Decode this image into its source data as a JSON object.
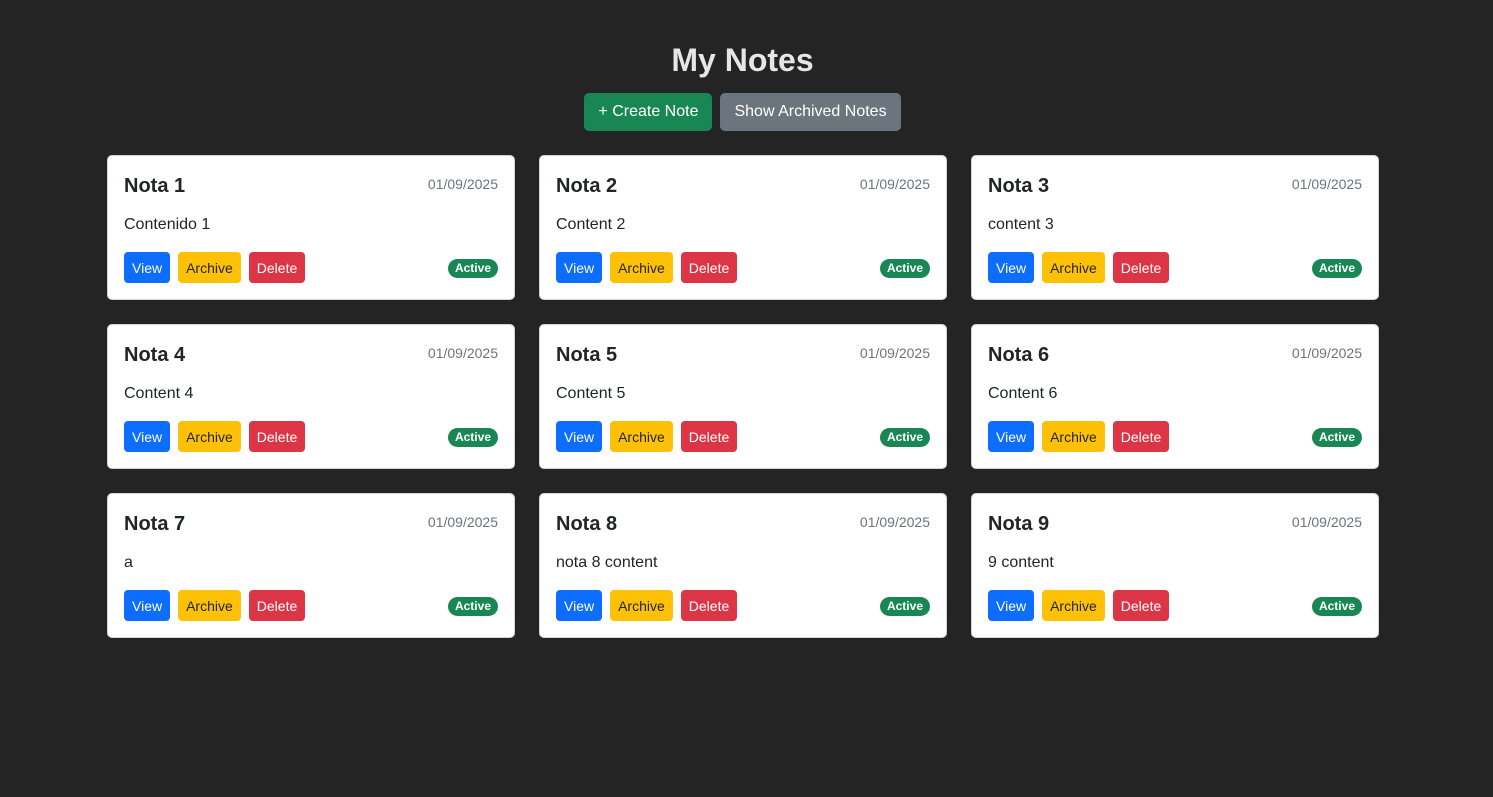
{
  "header": {
    "title": "My Notes",
    "create_label": "+ Create Note",
    "show_archived_label": "Show Archived Notes"
  },
  "colors": {
    "background": "#242424",
    "create": "#198754",
    "show_archived": "#6c757d",
    "view": "#0d6efd",
    "archive": "#ffc107",
    "delete": "#dc3545",
    "badge_active": "#198754"
  },
  "actions": {
    "view_label": "View",
    "archive_label": "Archive",
    "delete_label": "Delete"
  },
  "notes": [
    {
      "title": "Nota 1",
      "date": "01/09/2025",
      "content": "Contenido 1",
      "status": "Active"
    },
    {
      "title": "Nota 2",
      "date": "01/09/2025",
      "content": "Content 2",
      "status": "Active"
    },
    {
      "title": "Nota 3",
      "date": "01/09/2025",
      "content": "content 3",
      "status": "Active"
    },
    {
      "title": "Nota 4",
      "date": "01/09/2025",
      "content": "Content 4",
      "status": "Active"
    },
    {
      "title": "Nota 5",
      "date": "01/09/2025",
      "content": "Content 5",
      "status": "Active"
    },
    {
      "title": "Nota 6",
      "date": "01/09/2025",
      "content": "Content 6",
      "status": "Active"
    },
    {
      "title": "Nota 7",
      "date": "01/09/2025",
      "content": "a",
      "status": "Active"
    },
    {
      "title": "Nota 8",
      "date": "01/09/2025",
      "content": "nota 8 content",
      "status": "Active"
    },
    {
      "title": "Nota 9",
      "date": "01/09/2025",
      "content": "9 content",
      "status": "Active"
    }
  ]
}
